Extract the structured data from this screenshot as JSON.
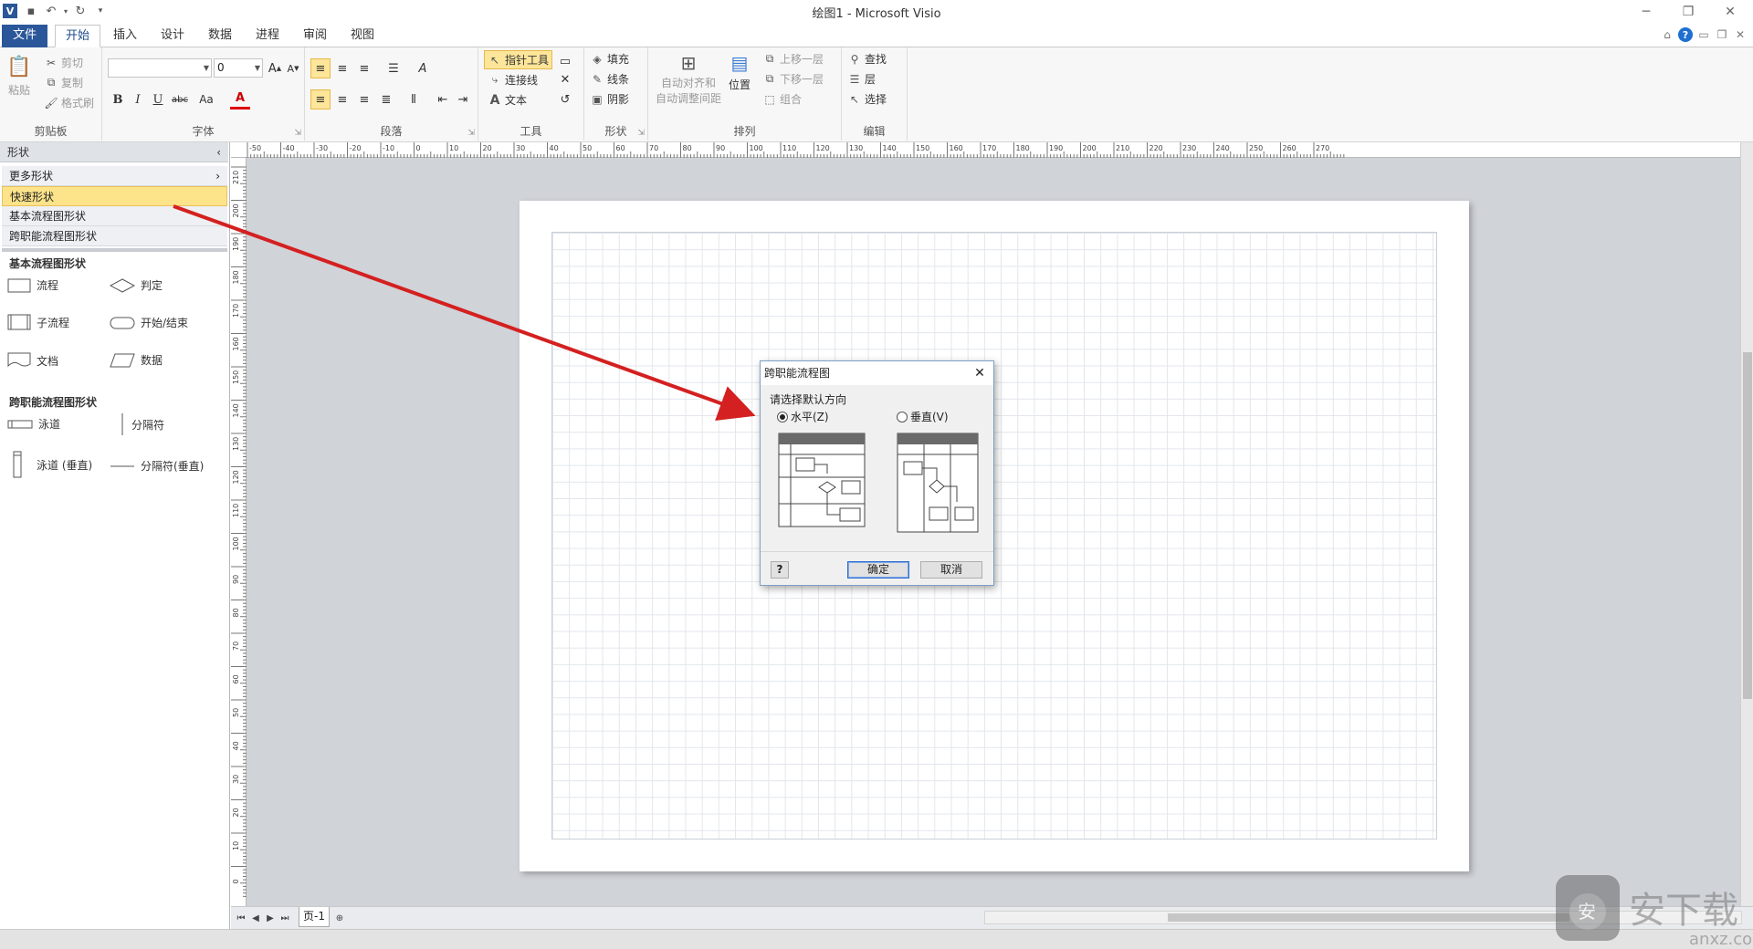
{
  "window": {
    "title": "绘图1  -  Microsoft Visio"
  },
  "tabs": [
    "文件",
    "开始",
    "插入",
    "设计",
    "数据",
    "进程",
    "审阅",
    "视图"
  ],
  "ribbon": {
    "clipboard": {
      "paste": "粘贴",
      "cut": "剪切",
      "copy": "复制",
      "format_painter": "格式刷",
      "label": "剪贴板"
    },
    "font": {
      "font_name": "",
      "font_size": "0",
      "label": "字体",
      "bold": "B",
      "italic": "I",
      "underline": "U",
      "strike": "abc",
      "case": "Aa"
    },
    "paragraph": {
      "label": "段落"
    },
    "tools": {
      "pointer": "指针工具",
      "connector": "连接线",
      "text": "文本",
      "label": "工具"
    },
    "shape": {
      "fill": "填充",
      "line": "线条",
      "shadow": "阴影",
      "label": "形状"
    },
    "arrange": {
      "align_line1": "自动对齐和",
      "align_line2": "自动调整间距",
      "position": "位置",
      "bring_forward": "上移一层",
      "send_backward": "下移一层",
      "group": "组合",
      "label": "排列"
    },
    "editing": {
      "find": "查找",
      "layers": "层",
      "select": "选择",
      "label": "编辑"
    }
  },
  "shapes_panel": {
    "header": "形状",
    "stencils": [
      "更多形状",
      "快速形状",
      "基本流程图形状",
      "跨职能流程图形状"
    ],
    "sections": [
      {
        "title": "基本流程图形状",
        "shapes": [
          "流程",
          "判定",
          "子流程",
          "开始/结束",
          "文档",
          "数据"
        ]
      },
      {
        "title": "跨职能流程图形状",
        "shapes": [
          "泳道",
          "分隔符",
          "泳道 (垂直)",
          "分隔符(垂直)"
        ]
      }
    ]
  },
  "ruler": {
    "h_labels": [
      "-50",
      "-40",
      "-30",
      "-20",
      "-10",
      "0",
      "10",
      "20",
      "30",
      "40",
      "50",
      "60",
      "70",
      "80",
      "90",
      "100",
      "110",
      "120",
      "130",
      "140",
      "150",
      "160",
      "170",
      "180",
      "190",
      "200",
      "210",
      "220",
      "230",
      "240",
      "250",
      "260",
      "270"
    ],
    "v_labels": [
      "210",
      "200",
      "190",
      "180",
      "170",
      "160",
      "150",
      "140",
      "130",
      "120",
      "110",
      "100",
      "90",
      "80",
      "70",
      "60",
      "50",
      "40",
      "30",
      "20",
      "10",
      "0"
    ]
  },
  "page_tab": "页-1",
  "dialog": {
    "title": "跨职能流程图",
    "prompt": "请选择默认方向",
    "horizontal": "水平(Z)",
    "vertical": "垂直(V)",
    "selected": "horizontal",
    "ok": "确定",
    "cancel": "取消",
    "help": "?"
  },
  "colors": {
    "file_tab": "#2b579a",
    "selected_stencil": "#fde38a",
    "arrow": "#d42020",
    "canvas": "#d0d3d8"
  }
}
